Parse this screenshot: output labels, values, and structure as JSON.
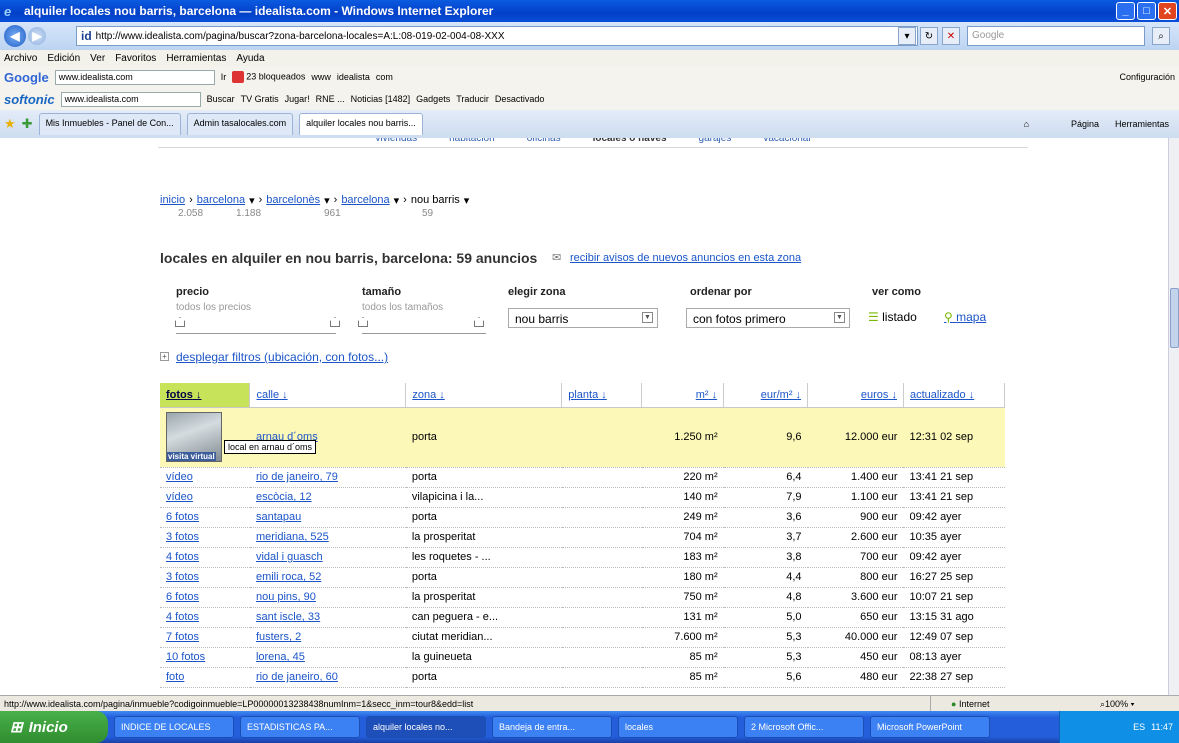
{
  "window": {
    "title": "alquiler locales nou barris, barcelona — idealista.com - Windows Internet Explorer"
  },
  "address": {
    "url": "http://www.idealista.com/pagina/buscar?zona-barcelona-locales=A:L:08-019-02-004-08-XXX",
    "search_placeholder": "Google"
  },
  "menu": [
    "Archivo",
    "Edición",
    "Ver",
    "Favoritos",
    "Herramientas",
    "Ayuda"
  ],
  "google_bar": {
    "input": "www.idealista.com",
    "go": "Ir",
    "blocked": "23 bloqueados",
    "links": [
      "www",
      "idealista",
      "com"
    ],
    "config": "Configuración"
  },
  "softonic_bar": {
    "input": "www.idealista.com",
    "items": [
      "Buscar",
      "TV Gratis",
      "Jugar!",
      "RNE ...",
      "Noticias [1482]",
      "Gadgets",
      "Traducir",
      "Desactivado"
    ]
  },
  "tabs": [
    "Mis Inmuebles - Panel de Con...",
    "Admin tasalocales.com",
    "alquiler locales nou barris..."
  ],
  "tab_tools": [
    "Página",
    "Herramientas"
  ],
  "site_nav": [
    "viviendas",
    "habitación",
    "oficinas",
    "locales o naves",
    "garajes",
    "vacacional"
  ],
  "breadcrumb": [
    {
      "label": "inicio",
      "count": "2.058"
    },
    {
      "label": "barcelona",
      "count": "1.188"
    },
    {
      "label": "barcelonès",
      "count": "961"
    },
    {
      "label": "barcelona",
      "count": "59"
    },
    {
      "label": "nou barris",
      "count": ""
    }
  ],
  "heading": "locales en alquiler en nou barris, barcelona: 59 anuncios",
  "alert_link": "recibir avisos de nuevos anuncios en esta zona",
  "filters": {
    "precio": {
      "label": "precio",
      "sub": "todos los precios"
    },
    "tamano": {
      "label": "tamaño",
      "sub": "todos los tamaños"
    },
    "zona": {
      "label": "elegir zona",
      "value": "nou barris"
    },
    "orden": {
      "label": "ordenar por",
      "value": "con fotos primero"
    },
    "ver": {
      "label": "ver como",
      "listado": "listado",
      "mapa": "mapa"
    },
    "expand": "desplegar filtros (ubicación, con fotos...)"
  },
  "table": {
    "headers": [
      "fotos",
      "calle",
      "zona",
      "planta",
      "m²",
      "eur/m²",
      "euros",
      "actualizado"
    ],
    "highlight": {
      "fotos": "visita virtual",
      "calle": "arnau d´oms",
      "zona": "porta",
      "planta": "",
      "m2": "1.250 m²",
      "eurm2": "9,6",
      "euros": "12.000 eur",
      "actualizado": "12:31 02 sep",
      "tooltip": "local en arnau d´oms"
    },
    "rows": [
      [
        "vídeo",
        "rio de janeiro, 79",
        "porta",
        "",
        "220 m²",
        "6,4",
        "1.400 eur",
        "13:41 21 sep"
      ],
      [
        "vídeo",
        "escòcia, 12",
        "vilapicina i la...",
        "",
        "140 m²",
        "7,9",
        "1.100 eur",
        "13:41 21 sep"
      ],
      [
        "6 fotos",
        "santapau",
        "porta",
        "",
        "249 m²",
        "3,6",
        "900 eur",
        "09:42 ayer"
      ],
      [
        "3 fotos",
        "meridiana, 525",
        "la prosperitat",
        "",
        "704 m²",
        "3,7",
        "2.600 eur",
        "10:35 ayer"
      ],
      [
        "4 fotos",
        "vidal i guasch",
        "les roquetes - ...",
        "",
        "183 m²",
        "3,8",
        "700 eur",
        "09:42 ayer"
      ],
      [
        "3 fotos",
        "emili roca, 52",
        "porta",
        "",
        "180 m²",
        "4,4",
        "800 eur",
        "16:27 25 sep"
      ],
      [
        "6 fotos",
        "nou pins, 90",
        "la prosperitat",
        "",
        "750 m²",
        "4,8",
        "3.600 eur",
        "10:07 21 sep"
      ],
      [
        "4 fotos",
        "sant iscle, 33",
        "can peguera - e...",
        "",
        "131 m²",
        "5,0",
        "650 eur",
        "13:15 31 ago"
      ],
      [
        "7 fotos",
        "fusters, 2",
        "ciutat meridian...",
        "",
        "7.600 m²",
        "5,3",
        "40.000 eur",
        "12:49 07 sep"
      ],
      [
        "10 fotos",
        "lorena, 45",
        "la guineueta",
        "",
        "85 m²",
        "5,3",
        "450 eur",
        "08:13 ayer"
      ],
      [
        "foto",
        "rio de janeiro, 60",
        "porta",
        "",
        "85 m²",
        "5,6",
        "480 eur",
        "22:38 27 sep"
      ]
    ]
  },
  "status": {
    "url": "http://www.idealista.com/pagina/inmueble?codigoinmueble=LP00000013238438numInm=1&secc_inm=tour8&edd=list",
    "zone": "Internet",
    "zoom": "100%"
  },
  "taskbar": {
    "start": "Inicio",
    "tasks": [
      "INDICE DE LOCALES",
      "ESTADISTICAS PA...",
      "alquiler locales no...",
      "Bandeja de entra...",
      "locales",
      "2 Microsoft Offic...",
      "Microsoft PowerPoint"
    ],
    "lang": "ES",
    "time": "11:47"
  }
}
